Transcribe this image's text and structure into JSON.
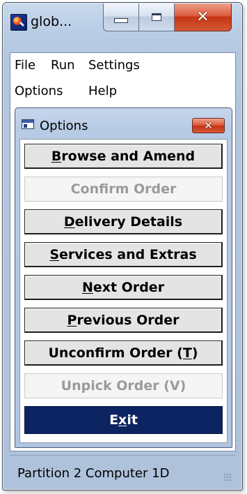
{
  "window": {
    "title": "glob...",
    "icon": "globe-magnifier-icon",
    "controls": {
      "minimize_icon": "minimize-icon",
      "maximize_icon": "maximize-icon",
      "close_icon": "close-icon",
      "close_glyph": "✕"
    }
  },
  "menubar": {
    "items": [
      "File",
      "Run",
      "Settings",
      "Options",
      "Help"
    ]
  },
  "options_window": {
    "title": "Options",
    "icon": "window-icon",
    "close_glyph": "✕",
    "buttons": [
      {
        "pre": "",
        "mnemonic": "B",
        "post": "rowse and Amend",
        "state": "enabled"
      },
      {
        "pre": "Confirm Order",
        "mnemonic": "",
        "post": "",
        "state": "disabled"
      },
      {
        "pre": "",
        "mnemonic": "D",
        "post": "elivery Details",
        "state": "enabled"
      },
      {
        "pre": "",
        "mnemonic": "S",
        "post": "ervices and Extras",
        "state": "enabled"
      },
      {
        "pre": "",
        "mnemonic": "N",
        "post": "ext Order",
        "state": "enabled"
      },
      {
        "pre": "",
        "mnemonic": "P",
        "post": "revious Order",
        "state": "enabled"
      },
      {
        "pre": "Unconfirm Order (",
        "mnemonic": "T",
        "post": ")",
        "state": "enabled"
      },
      {
        "pre": "Unpick Order (V)",
        "mnemonic": "",
        "post": "",
        "state": "disabled"
      },
      {
        "pre": "E",
        "mnemonic": "x",
        "post": "it",
        "state": "primary"
      }
    ]
  },
  "statusbar": {
    "text": "Partition 2 Computer 1D",
    "grip_icon": "resize-grip-icon"
  },
  "colors": {
    "frame": "#b9cde6",
    "exit_button": "#0c2461",
    "close_button": "#c43414",
    "disabled_text": "#9a9a9a"
  }
}
